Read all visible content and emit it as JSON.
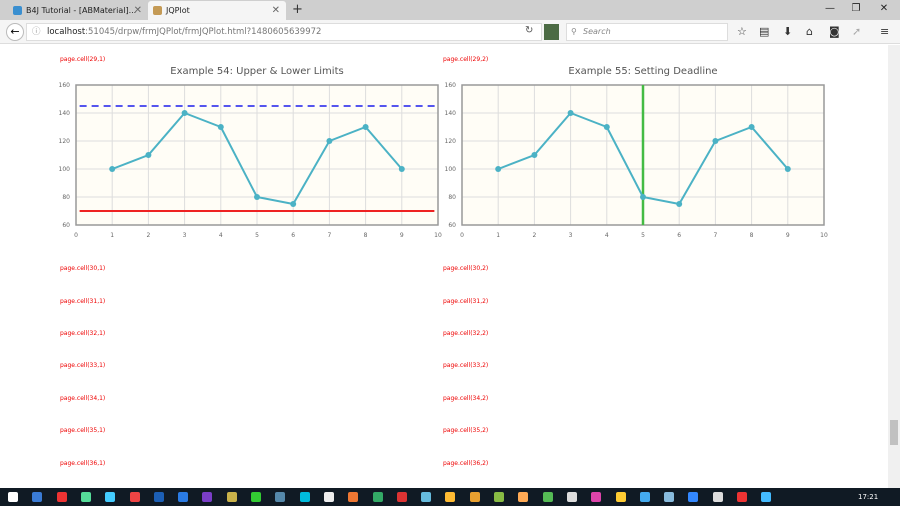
{
  "browser": {
    "tabs": [
      {
        "label": "B4J Tutorial - [ABMaterial]..."
      },
      {
        "label": "JQPlot"
      }
    ],
    "url_host": "localhost",
    "url_rest": ":51045/drpw/frmJQPlot/frmJQPlot.html?1480605639972",
    "search_placeholder": "Search"
  },
  "cells": {
    "left": [
      "page.cell(29,1)",
      "page.cell(30,1)",
      "page.cell(31,1)",
      "page.cell(32,1)",
      "page.cell(33,1)",
      "page.cell(34,1)",
      "page.cell(35,1)",
      "page.cell(36,1)"
    ],
    "right": [
      "page.cell(29,2)",
      "page.cell(30,2)",
      "page.cell(31,2)",
      "page.cell(32,2)",
      "page.cell(33,2)",
      "page.cell(34,2)",
      "page.cell(35,2)",
      "page.cell(36,2)"
    ]
  },
  "chart_data": [
    {
      "type": "line",
      "title": "Example 54: Upper & Lower Limits",
      "x": [
        1,
        2,
        3,
        4,
        5,
        6,
        7,
        8,
        9
      ],
      "values": [
        100,
        110,
        140,
        130,
        80,
        75,
        120,
        130,
        100
      ],
      "xlim": [
        0,
        10
      ],
      "ylim": [
        60,
        160
      ],
      "xticks": [
        0,
        1,
        2,
        3,
        4,
        5,
        6,
        7,
        8,
        9,
        10
      ],
      "yticks": [
        60,
        80,
        100,
        120,
        140,
        160
      ],
      "upper_limit": 145,
      "lower_limit": 70,
      "series_color": "#4bb2c5",
      "upper_color": "#5555ee",
      "lower_color": "#ee2222"
    },
    {
      "type": "line",
      "title": "Example 55: Setting Deadline",
      "x": [
        1,
        2,
        3,
        4,
        5,
        6,
        7,
        8,
        9
      ],
      "values": [
        100,
        110,
        140,
        130,
        80,
        75,
        120,
        130,
        100
      ],
      "xlim": [
        0,
        10
      ],
      "ylim": [
        60,
        160
      ],
      "xticks": [
        0,
        1,
        2,
        3,
        4,
        5,
        6,
        7,
        8,
        9,
        10
      ],
      "yticks": [
        60,
        80,
        100,
        120,
        140,
        160
      ],
      "deadline_x": 5,
      "series_color": "#4bb2c5",
      "deadline_color": "#44bb44"
    }
  ],
  "clock": "17:21"
}
